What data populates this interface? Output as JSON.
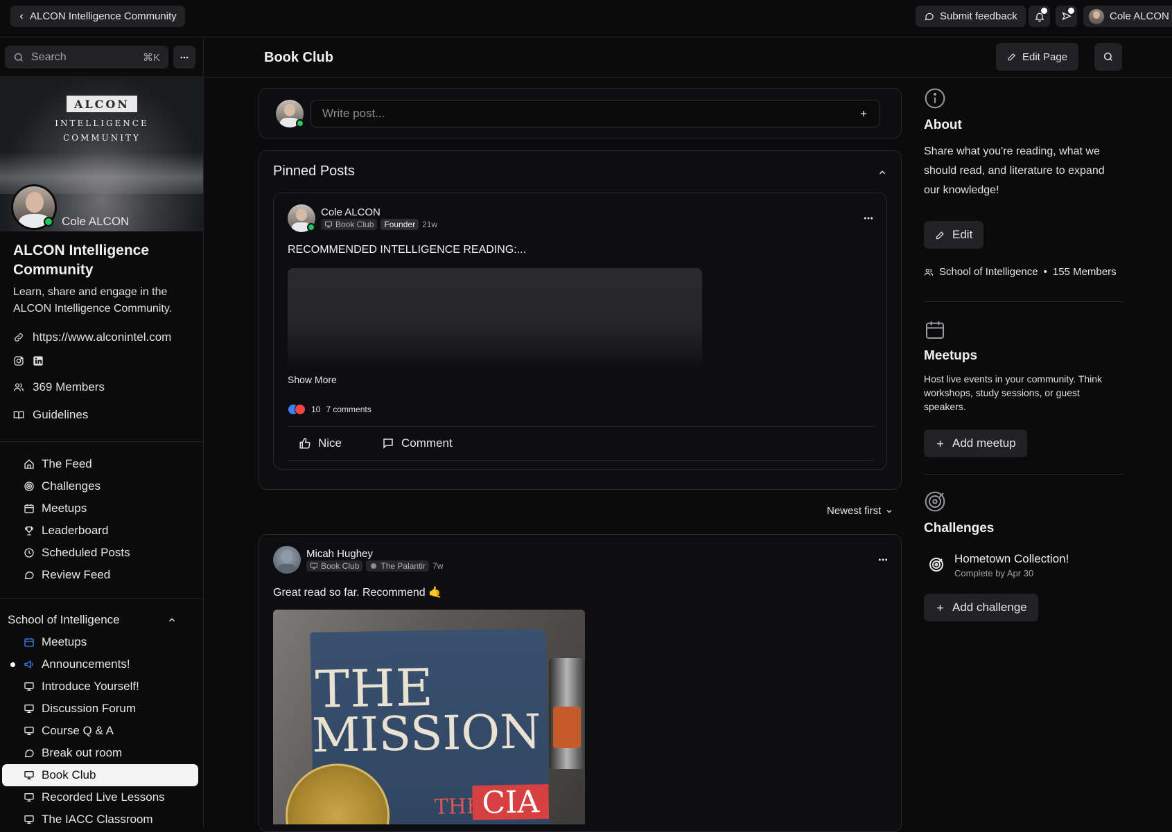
{
  "topbar": {
    "back_label": "ALCON Intelligence Community",
    "feedback_label": "Submit feedback",
    "user_name": "Cole ALCON"
  },
  "sidebar": {
    "search_placeholder": "Search",
    "search_shortcut": "⌘K",
    "banner": {
      "logo_word": "ALCON",
      "line1": "Intelligence",
      "line2": "Community"
    },
    "owner_name": "Cole ALCON",
    "community_title": "ALCON Intelligence Community",
    "community_description": "Learn, share and engage in the ALCON Intelligence Community.",
    "website": "https://www.alconintel.com",
    "members": "369 Members",
    "guidelines": "Guidelines",
    "nav": [
      {
        "label": "The Feed",
        "icon": "home-icon"
      },
      {
        "label": "Challenges",
        "icon": "target-icon"
      },
      {
        "label": "Meetups",
        "icon": "calendar-icon"
      },
      {
        "label": "Leaderboard",
        "icon": "trophy-icon"
      },
      {
        "label": "Scheduled Posts",
        "icon": "clock-icon"
      },
      {
        "label": "Review Feed",
        "icon": "chat-icon"
      }
    ],
    "section_title": "School of Intelligence",
    "section_items": [
      {
        "label": "Meetups",
        "icon": "calendar-icon",
        "color": "#3b82f6"
      },
      {
        "label": "Announcements!",
        "icon": "megaphone-icon",
        "color": "#3b82f6"
      },
      {
        "label": "Introduce Yourself!",
        "icon": "monitor-icon"
      },
      {
        "label": "Discussion Forum",
        "icon": "monitor-icon"
      },
      {
        "label": "Course Q & A",
        "icon": "monitor-icon"
      },
      {
        "label": "Break out room",
        "icon": "chat-icon"
      },
      {
        "label": "Book Club",
        "icon": "monitor-icon",
        "active": true
      },
      {
        "label": "Recorded Live Lessons",
        "icon": "monitor-icon"
      },
      {
        "label": "The IACC Classroom",
        "icon": "monitor-icon"
      }
    ]
  },
  "header": {
    "title": "Book Club",
    "edit_page_label": "Edit Page"
  },
  "composer": {
    "placeholder": "Write post..."
  },
  "pinned": {
    "title": "Pinned Posts",
    "post": {
      "author": "Cole ALCON",
      "space": "Book Club",
      "role": "Founder",
      "age": "21w",
      "body": "RECOMMENDED INTELLIGENCE READING:...",
      "show_more": "Show More",
      "reaction_count": "10",
      "comments": "7 comments",
      "like_label": "Nice",
      "comment_label": "Comment"
    }
  },
  "sort": {
    "label": "Newest first"
  },
  "post2": {
    "author": "Micah Hughey",
    "space": "Book Club",
    "badge": "The Palantir",
    "age": "7w",
    "body": "Great read so far. Recommend 🤙",
    "book": {
      "line1": "THE",
      "line2": "MISSION",
      "the": "THE",
      "cia": "CIA"
    }
  },
  "right": {
    "about_title": "About",
    "about_text": "Share what you're reading, what we should read, and literature to expand our knowledge!",
    "edit_label": "Edit",
    "meta_group": "School of Intelligence",
    "meta_members": "155 Members",
    "meetups_title": "Meetups",
    "meetups_text": "Host live events in your community. Think workshops, study sessions, or guest speakers.",
    "add_meetup": "Add meetup",
    "challenges_title": "Challenges",
    "challenge_name": "Hometown Collection!",
    "challenge_sub": "Complete by Apr 30",
    "add_challenge": "Add challenge"
  }
}
